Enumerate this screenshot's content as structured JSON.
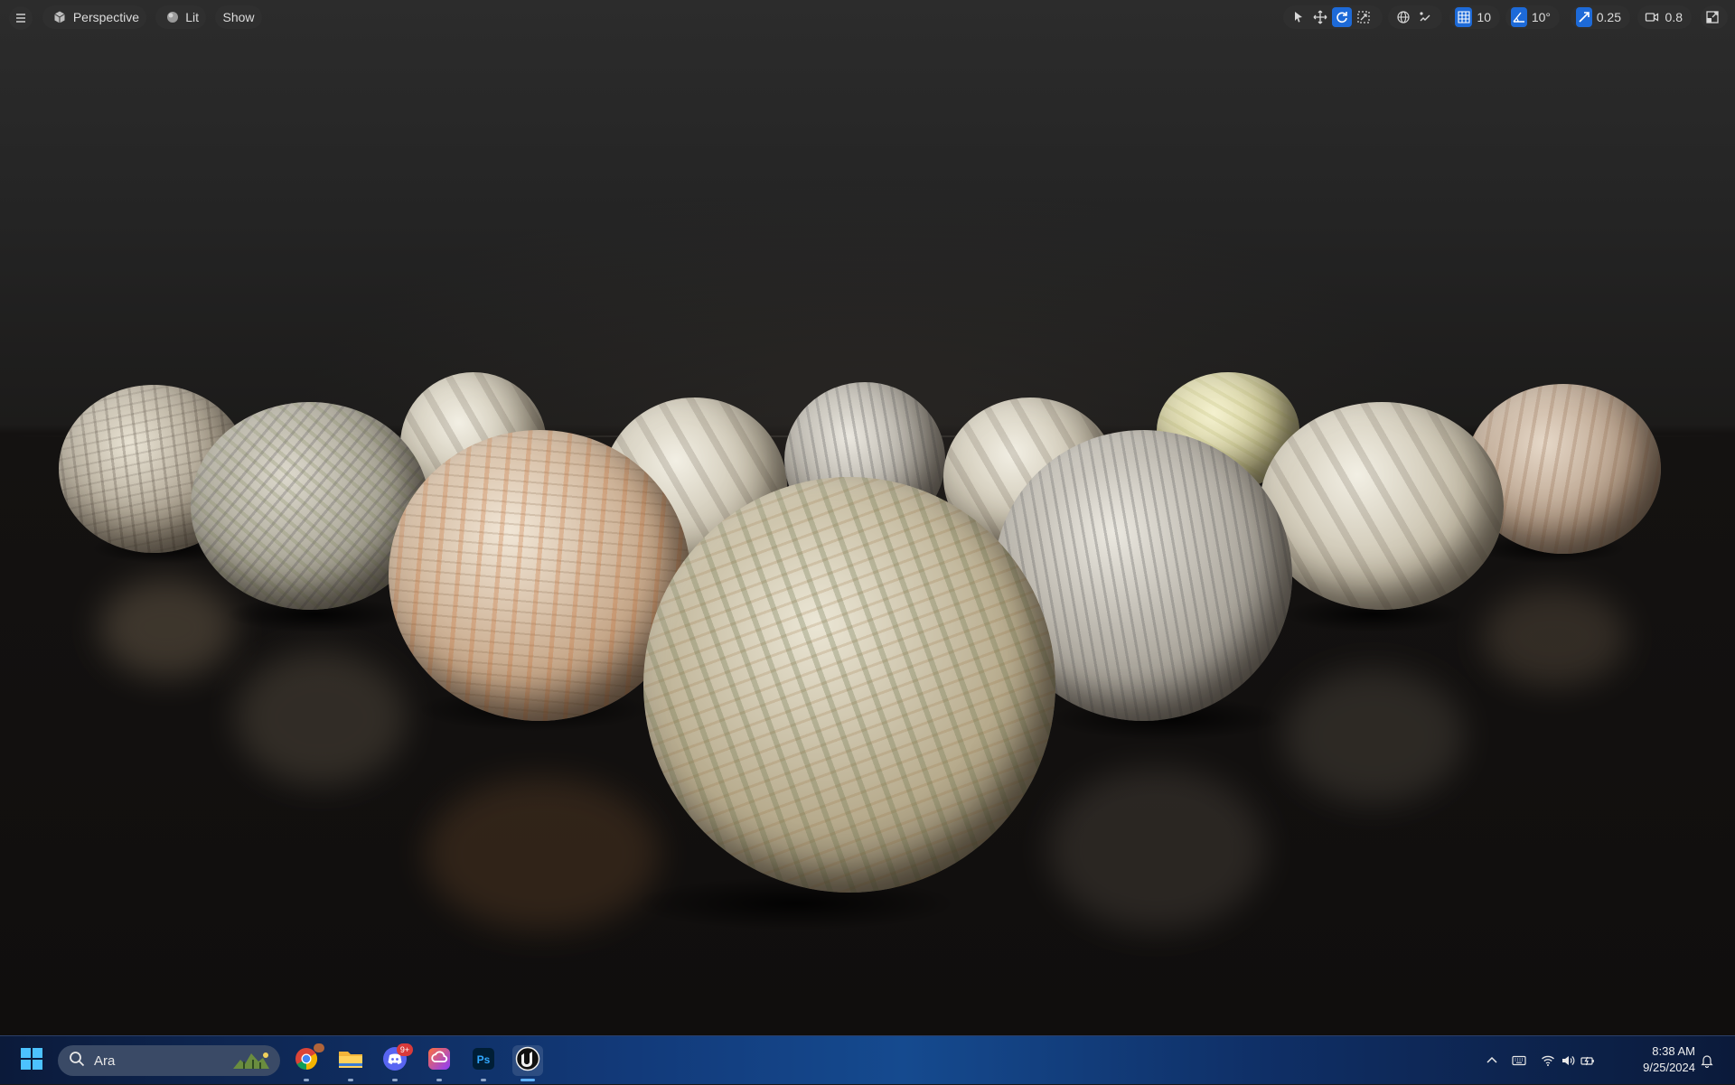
{
  "viewport": {
    "toolbar": {
      "view_mode": "Perspective",
      "lighting": "Lit",
      "show": "Show",
      "grid_snap": "10",
      "rotation_snap": "10°",
      "scale_snap": "0.25",
      "camera_speed": "0.8"
    }
  },
  "taskbar": {
    "search_text": "Ara",
    "discord_badge": "9+",
    "chrome_badge": "",
    "time": "8:38 AM",
    "date": "9/25/2024"
  },
  "colors": {
    "accent": "#1d6ad8",
    "toolbar_bg": "#2f2f2f",
    "taskbar_bg": "#123a7a"
  }
}
